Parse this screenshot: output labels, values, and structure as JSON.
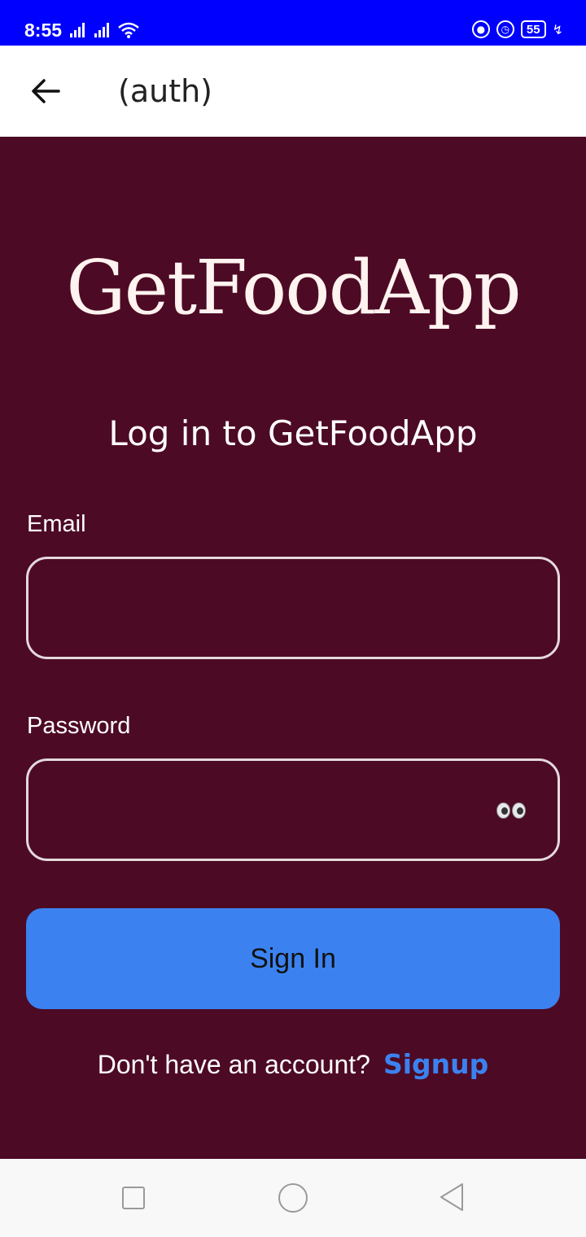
{
  "status_bar": {
    "time": "8:55",
    "battery_level": "55",
    "icons": [
      "signal-icon",
      "signal-icon",
      "wifi-icon",
      "lock-icon",
      "alarm-icon",
      "battery-icon",
      "charging-icon"
    ]
  },
  "header": {
    "title": "(auth)",
    "back_icon": "arrow-left-icon"
  },
  "logo": {
    "text": "GetFoodApp"
  },
  "login": {
    "title": "Log in to GetFoodApp",
    "email_label": "Email",
    "email_value": "",
    "password_label": "Password",
    "password_value": "",
    "show_password_icon": "eyes-icon",
    "sign_in_label": "Sign In",
    "signup_prompt": "Don't have an account?",
    "signup_link": "Signup"
  },
  "colors": {
    "background": "#4d0a24",
    "status_bar": "#0000ff",
    "accent": "#3b82f0"
  },
  "nav_bar": {
    "icons": [
      "recents-icon",
      "home-icon",
      "back-icon"
    ]
  }
}
